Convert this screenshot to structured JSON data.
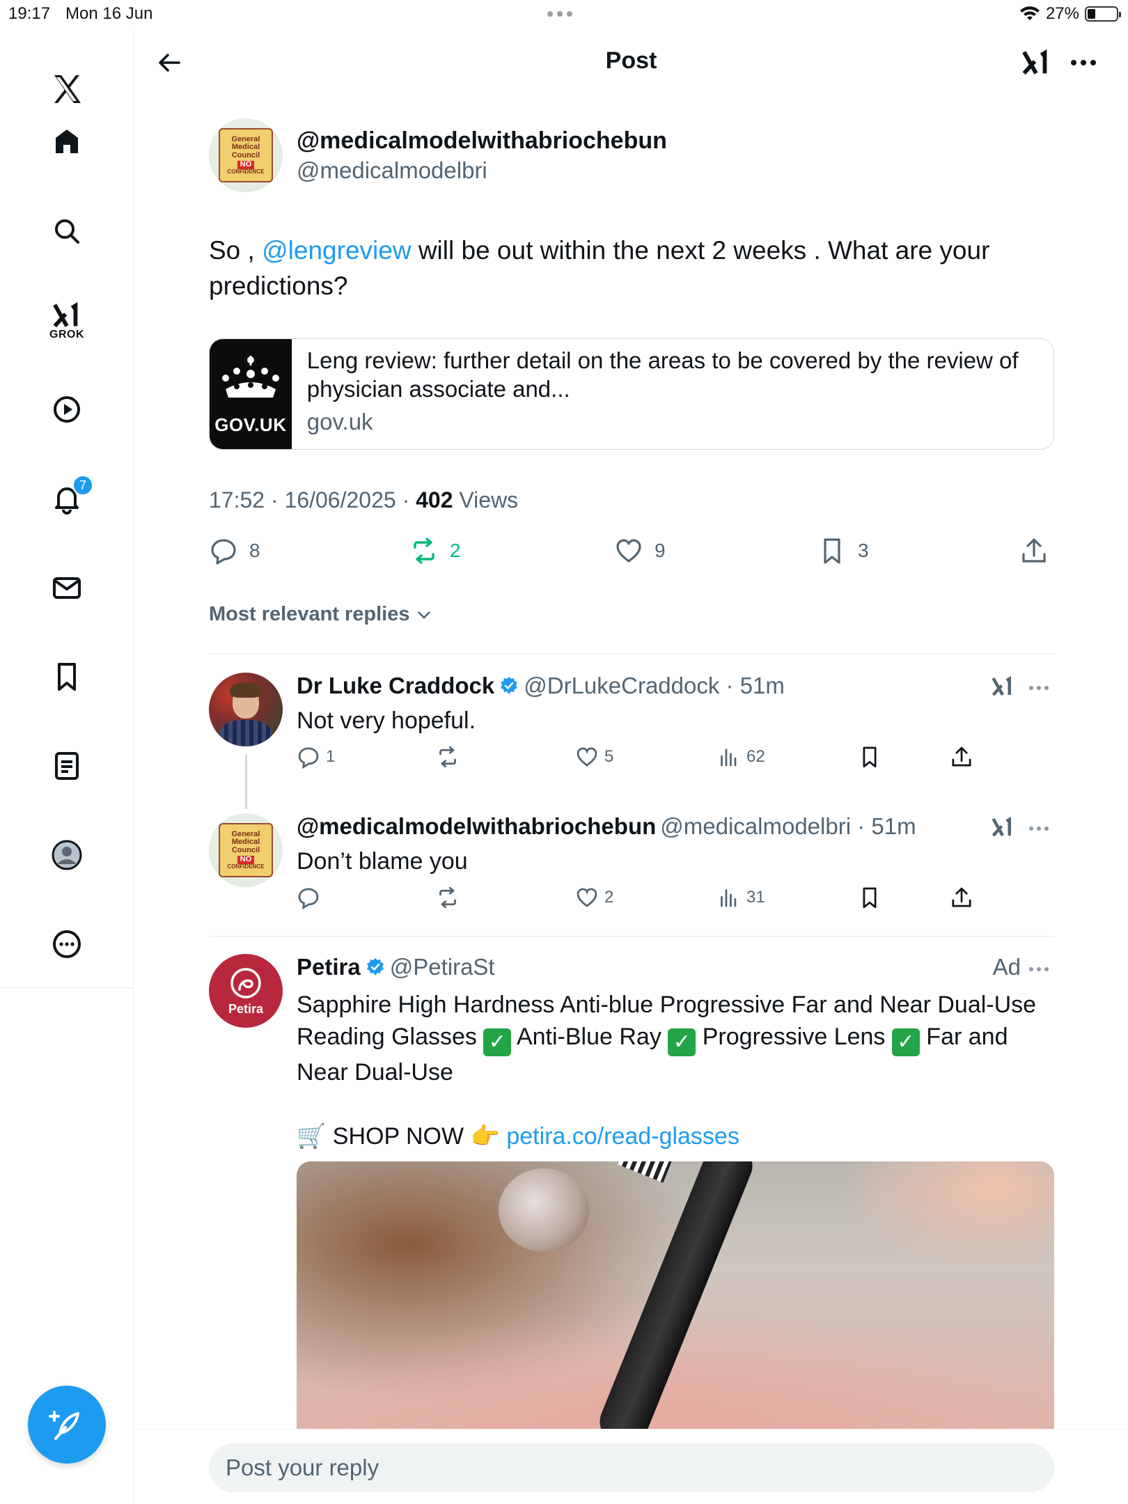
{
  "status_bar": {
    "time": "19:17",
    "date": "Mon 16 Jun",
    "battery": "27%",
    "battery_level": 0.27
  },
  "nav": {
    "grok_label": "GROK",
    "notifications_badge": "7",
    "items": [
      "x-logo-icon",
      "home-icon",
      "search-icon",
      "grok-icon",
      "video-icon",
      "notifications-icon",
      "messages-icon",
      "bookmarks-icon",
      "lists-icon",
      "profile-icon",
      "more-icon"
    ]
  },
  "header": {
    "title": "Post"
  },
  "post": {
    "author_name": "@medicalmodelwithabriochebun",
    "author_handle": "@medicalmodelbri",
    "avatar_text": [
      "General",
      "Medical",
      "Council",
      "NO",
      "CONFIDENCE"
    ],
    "text_before": "So , ",
    "mention": "@lengreview",
    "text_after": "  will be out within the next 2 weeks . What are your predictions?",
    "card": {
      "thumb_label": "GOV.UK",
      "title": "Leng review: further detail on the areas to be covered by the review of physician associate and...",
      "domain": "gov.uk"
    },
    "timestamp": "17:52 · 16/06/2025 · ",
    "views_count": "402",
    "views_label": " Views",
    "stats": {
      "replies": "8",
      "reposts": "2",
      "likes": "9",
      "bookmarks": "3"
    }
  },
  "replies_sort": "Most relevant replies",
  "replies": [
    {
      "name": "Dr Luke Craddock",
      "handle": "@DrLukeCraddock · 51m",
      "text": "Not very hopeful.",
      "replies": "1",
      "reposts": "",
      "likes": "5",
      "views": "62"
    },
    {
      "name": "@medicalmodelwithabriochebun",
      "handle": "@medicalmodelbri · 51m",
      "text": "Don’t blame you",
      "replies": "",
      "reposts": "",
      "likes": "2",
      "views": "31"
    }
  ],
  "ad": {
    "name": "Petira",
    "handle": "@PetiraSt",
    "avatar_label": "Petira",
    "ad_label": "Ad",
    "text_part1": "Sapphire High Hardness Anti-blue Progressive Far and Near Dual-Use Reading Glasses ",
    "text_part2": " Anti-Blue Ray ",
    "text_part3": " Progressive Lens ",
    "text_part4": " Far and Near Dual-Use",
    "shop_emoji": "🛒",
    "shop_label": " SHOP NOW ",
    "point_emoji": "👉",
    "link": "petira.co/read-glasses"
  },
  "composer": {
    "placeholder": "Post your reply"
  },
  "colors": {
    "accent": "#1d9bf0",
    "repost_green": "#00ba7c",
    "muted": "#536471"
  }
}
